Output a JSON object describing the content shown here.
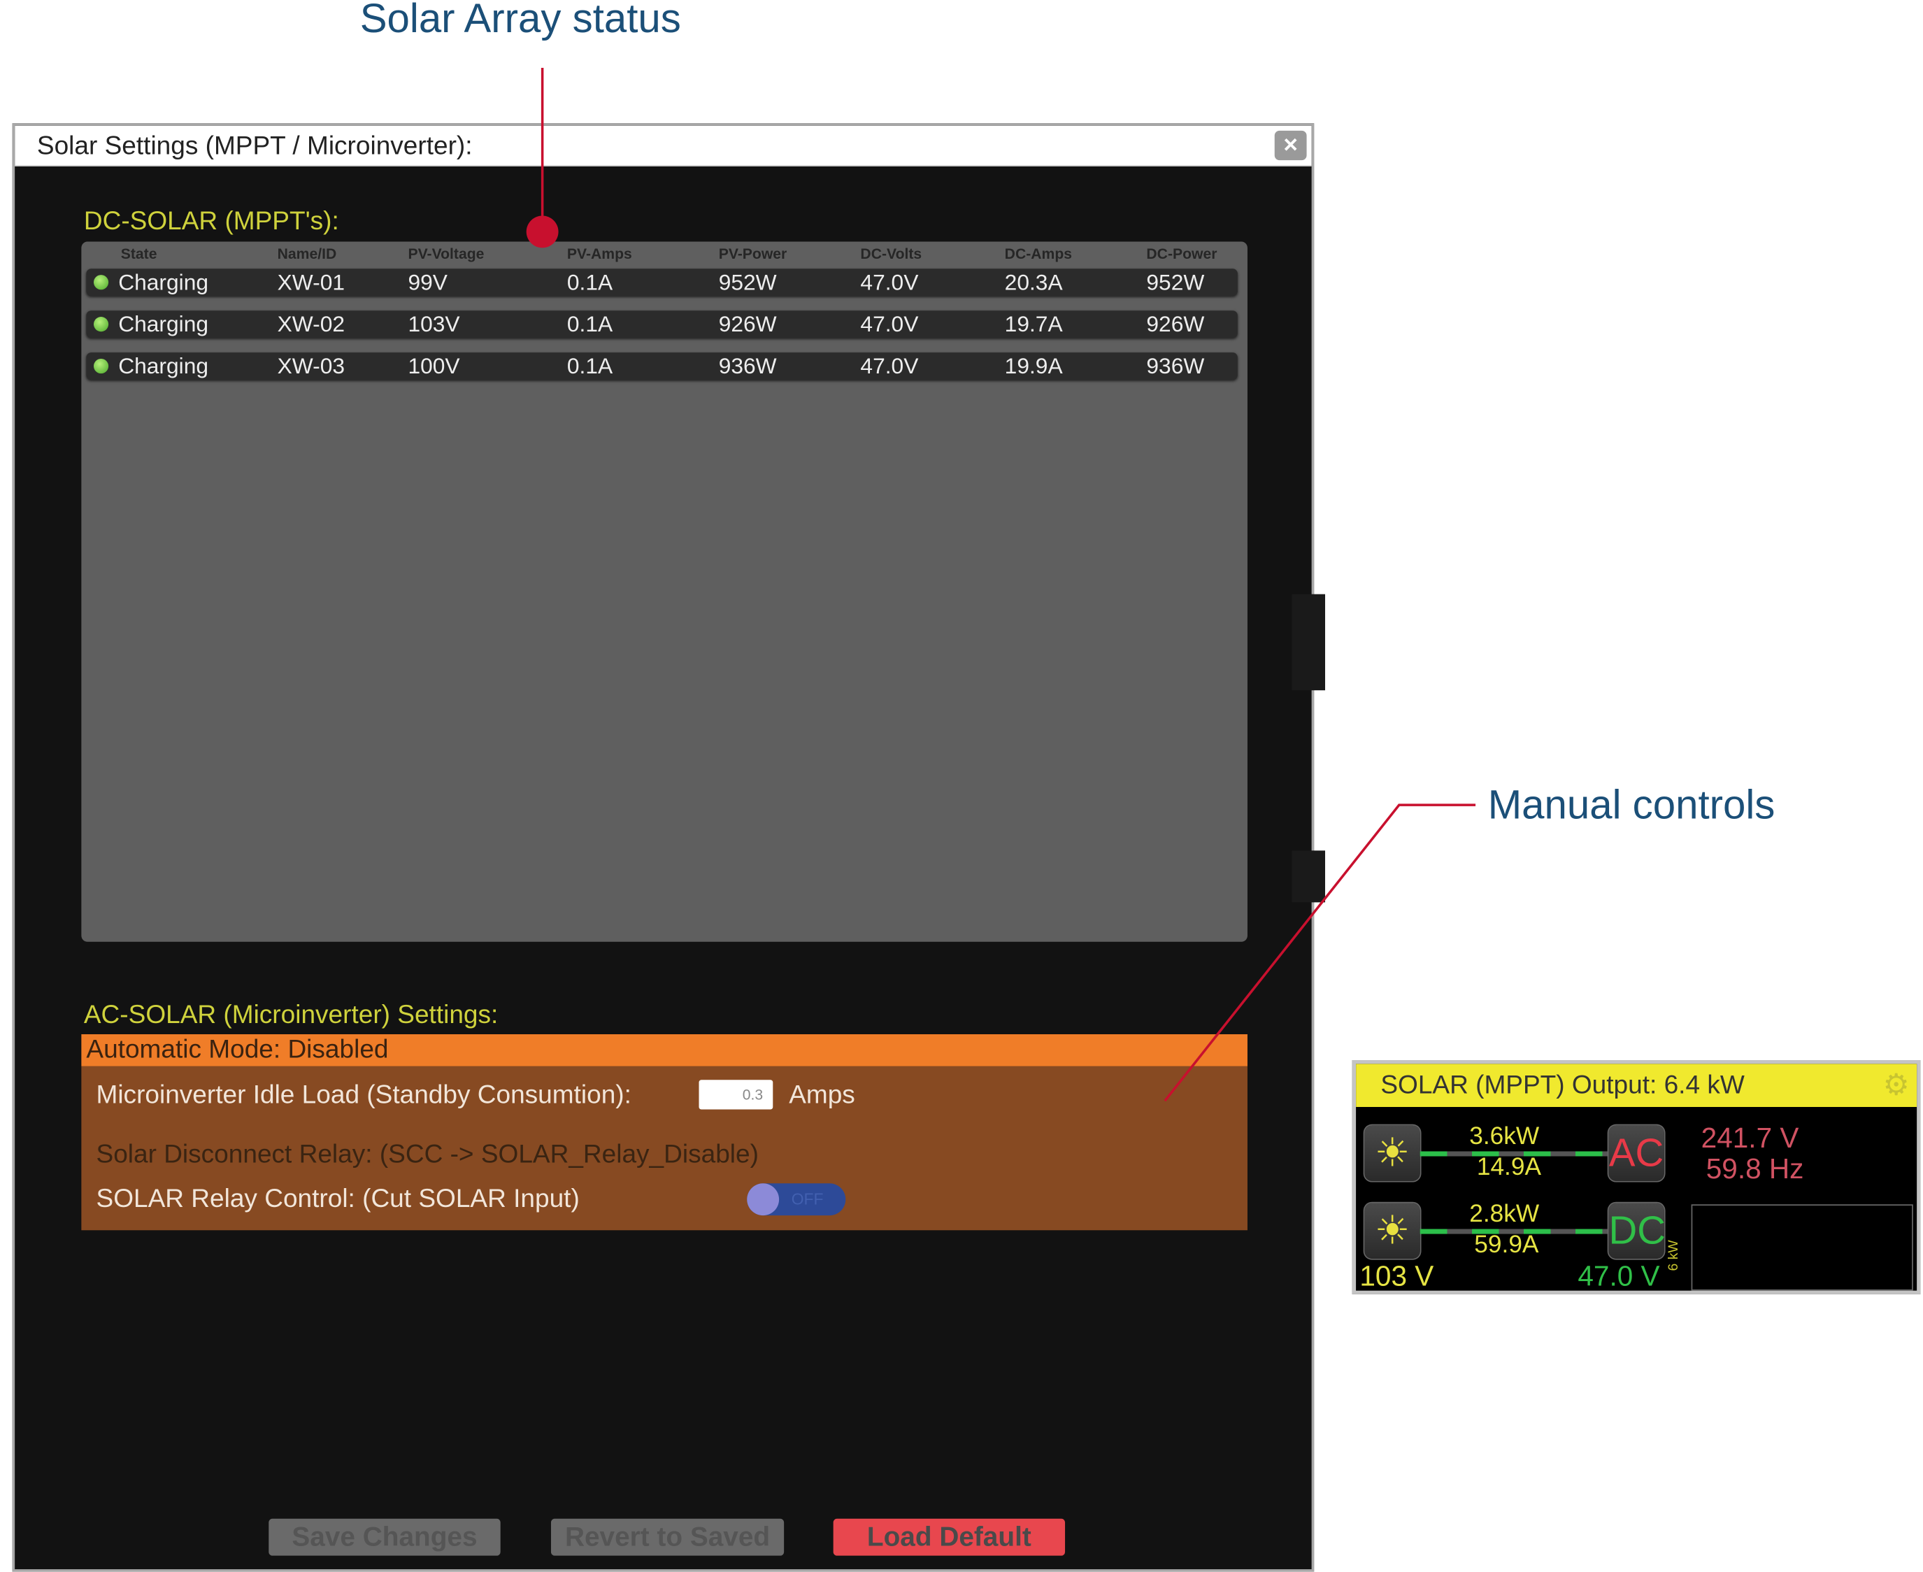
{
  "annotations": {
    "solar_array_status": "Solar Array status",
    "manual_controls": "Manual controls",
    "color": "#c8102e"
  },
  "window": {
    "title": "Solar Settings (MPPT / Microinverter):",
    "close_icon": "close-icon"
  },
  "dc_solar": {
    "heading": "DC-SOLAR (MPPT's):",
    "columns": [
      "State",
      "Name/ID",
      "PV-Voltage",
      "PV-Amps",
      "PV-Power",
      "DC-Volts",
      "DC-Amps",
      "DC-Power"
    ],
    "rows": [
      [
        "Charging",
        "XW-01",
        "99V",
        "0.1A",
        "952W",
        "47.0V",
        "20.3A",
        "952W"
      ],
      [
        "Charging",
        "XW-02",
        "103V",
        "0.1A",
        "926W",
        "47.0V",
        "19.7A",
        "926W"
      ],
      [
        "Charging",
        "XW-03",
        "100V",
        "0.1A",
        "936W",
        "47.0V",
        "19.9A",
        "936W"
      ]
    ],
    "status_color": "#5cc030"
  },
  "ac_solar": {
    "heading": "AC-SOLAR (Microinverter) Settings:",
    "automatic_mode": "Automatic Mode:  Disabled",
    "idle_load_label": "Microinverter Idle Load (Standby Consumtion):",
    "idle_load_value": "0.3",
    "idle_load_unit": "Amps",
    "disconnect_relay": "Solar Disconnect Relay:  (SCC -> SOLAR_Relay_Disable)",
    "relay_control_label": "SOLAR Relay Control: (Cut SOLAR Input)",
    "relay_toggle": "OFF"
  },
  "buttons": {
    "save": "Save Changes",
    "revert": "Revert to Saved",
    "load_default": "Load Default"
  },
  "widget": {
    "title": "SOLAR (MPPT) Output: 6.4 kW",
    "ac_label": "AC",
    "dc_label": "DC",
    "ac_power": "3.6kW",
    "ac_current": "14.9A",
    "ac_voltage": "241.7 V",
    "ac_freq": "59.8 Hz",
    "dc_power": "2.8kW",
    "dc_current": "59.9A",
    "pv_voltage": "103 V",
    "dc_voltage": "47.0 V",
    "chart_scale": "6 kW"
  }
}
